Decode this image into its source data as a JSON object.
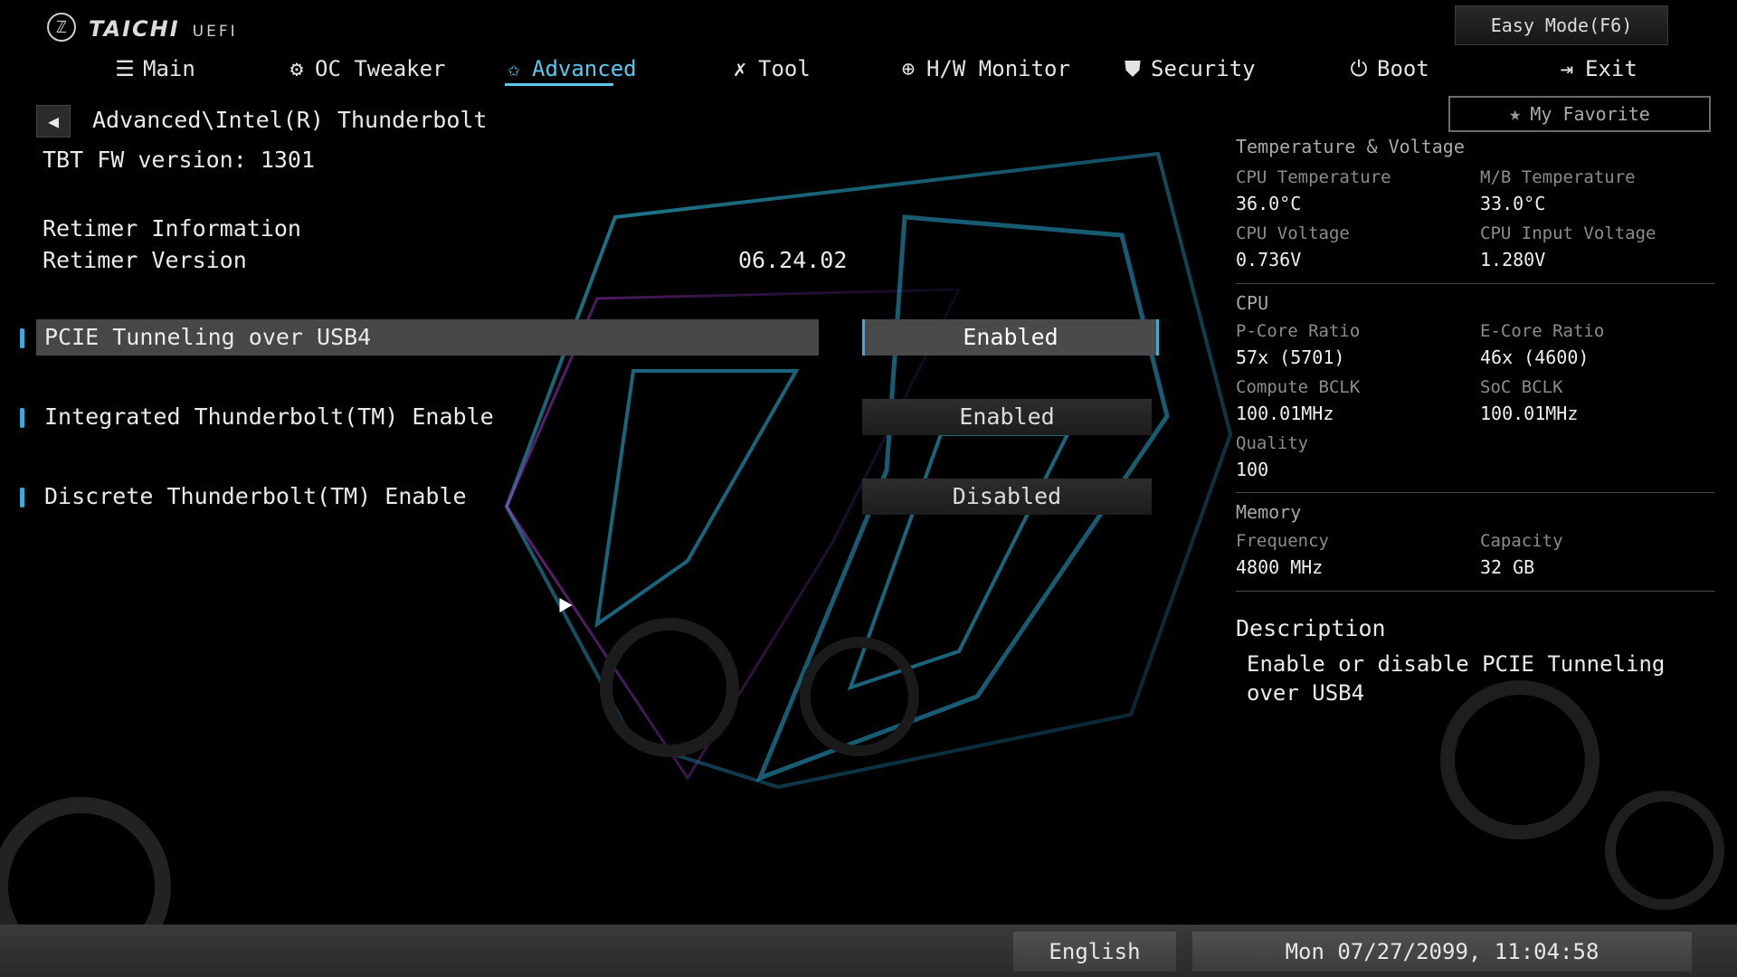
{
  "header": {
    "brand": "TAICHI",
    "brand_mark": "ℤ",
    "uefi": "UEFI",
    "easy_mode_label": "Easy Mode(F6)",
    "favorite_label": "My Favorite"
  },
  "nav": {
    "tabs": [
      {
        "label": "Main",
        "icon": "list-icon",
        "glyph": "☰"
      },
      {
        "label": "OC Tweaker",
        "icon": "rocket-icon",
        "glyph": "⚙"
      },
      {
        "label": "Advanced",
        "icon": "star-icon",
        "glyph": "✩"
      },
      {
        "label": "Tool",
        "icon": "tools-icon",
        "glyph": "✗"
      },
      {
        "label": "H/W Monitor",
        "icon": "monitor-icon",
        "glyph": "⊕"
      },
      {
        "label": "Security",
        "icon": "shield-icon",
        "glyph": "⛊"
      },
      {
        "label": "Boot",
        "icon": "power-icon",
        "glyph": "⏻"
      },
      {
        "label": "Exit",
        "icon": "exit-icon",
        "glyph": "⇥"
      }
    ],
    "active_index": 2
  },
  "page": {
    "breadcrumb": "Advanced\\Intel(R) Thunderbolt",
    "fw_version": "TBT FW version: 1301",
    "retimer_info": "Retimer Information",
    "retimer_version_label": "Retimer Version",
    "retimer_version_value": "06.24.02"
  },
  "options": [
    {
      "label": "PCIE Tunneling over USB4",
      "value": "Enabled",
      "selected": true
    },
    {
      "label": "Integrated Thunderbolt(TM) Enable",
      "value": "Enabled",
      "selected": false
    },
    {
      "label": "Discrete Thunderbolt(TM) Enable",
      "value": "Disabled",
      "selected": false
    }
  ],
  "monitor": {
    "temp_voltage_title": "Temperature & Voltage",
    "cpu_temp_label": "CPU Temperature",
    "cpu_temp_value": "36.0°C",
    "mb_temp_label": "M/B Temperature",
    "mb_temp_value": "33.0°C",
    "cpu_voltage_label": "CPU Voltage",
    "cpu_voltage_value": "0.736V",
    "cpu_input_voltage_label": "CPU Input Voltage",
    "cpu_input_voltage_value": "1.280V",
    "cpu_title": "CPU",
    "pcore_label": "P-Core Ratio",
    "pcore_value": "57x (5701)",
    "ecore_label": "E-Core Ratio",
    "ecore_value": "46x (4600)",
    "compute_bclk_label": "Compute BCLK",
    "compute_bclk_value": "100.01MHz",
    "soc_bclk_label": "SoC BCLK",
    "soc_bclk_value": "100.01MHz",
    "quality_label": "Quality",
    "quality_value": "100",
    "memory_title": "Memory",
    "frequency_label": "Frequency",
    "frequency_value": "4800 MHz",
    "capacity_label": "Capacity",
    "capacity_value": "32 GB"
  },
  "description": {
    "title": "Description",
    "text": "Enable or disable PCIE Tunneling over USB4"
  },
  "footer": {
    "language": "English",
    "datetime": "Mon 07/27/2099, 11:04:58"
  },
  "colors": {
    "accent": "#5cc8ee",
    "marker": "#3fa9d9",
    "selected_bg": "#474747"
  }
}
